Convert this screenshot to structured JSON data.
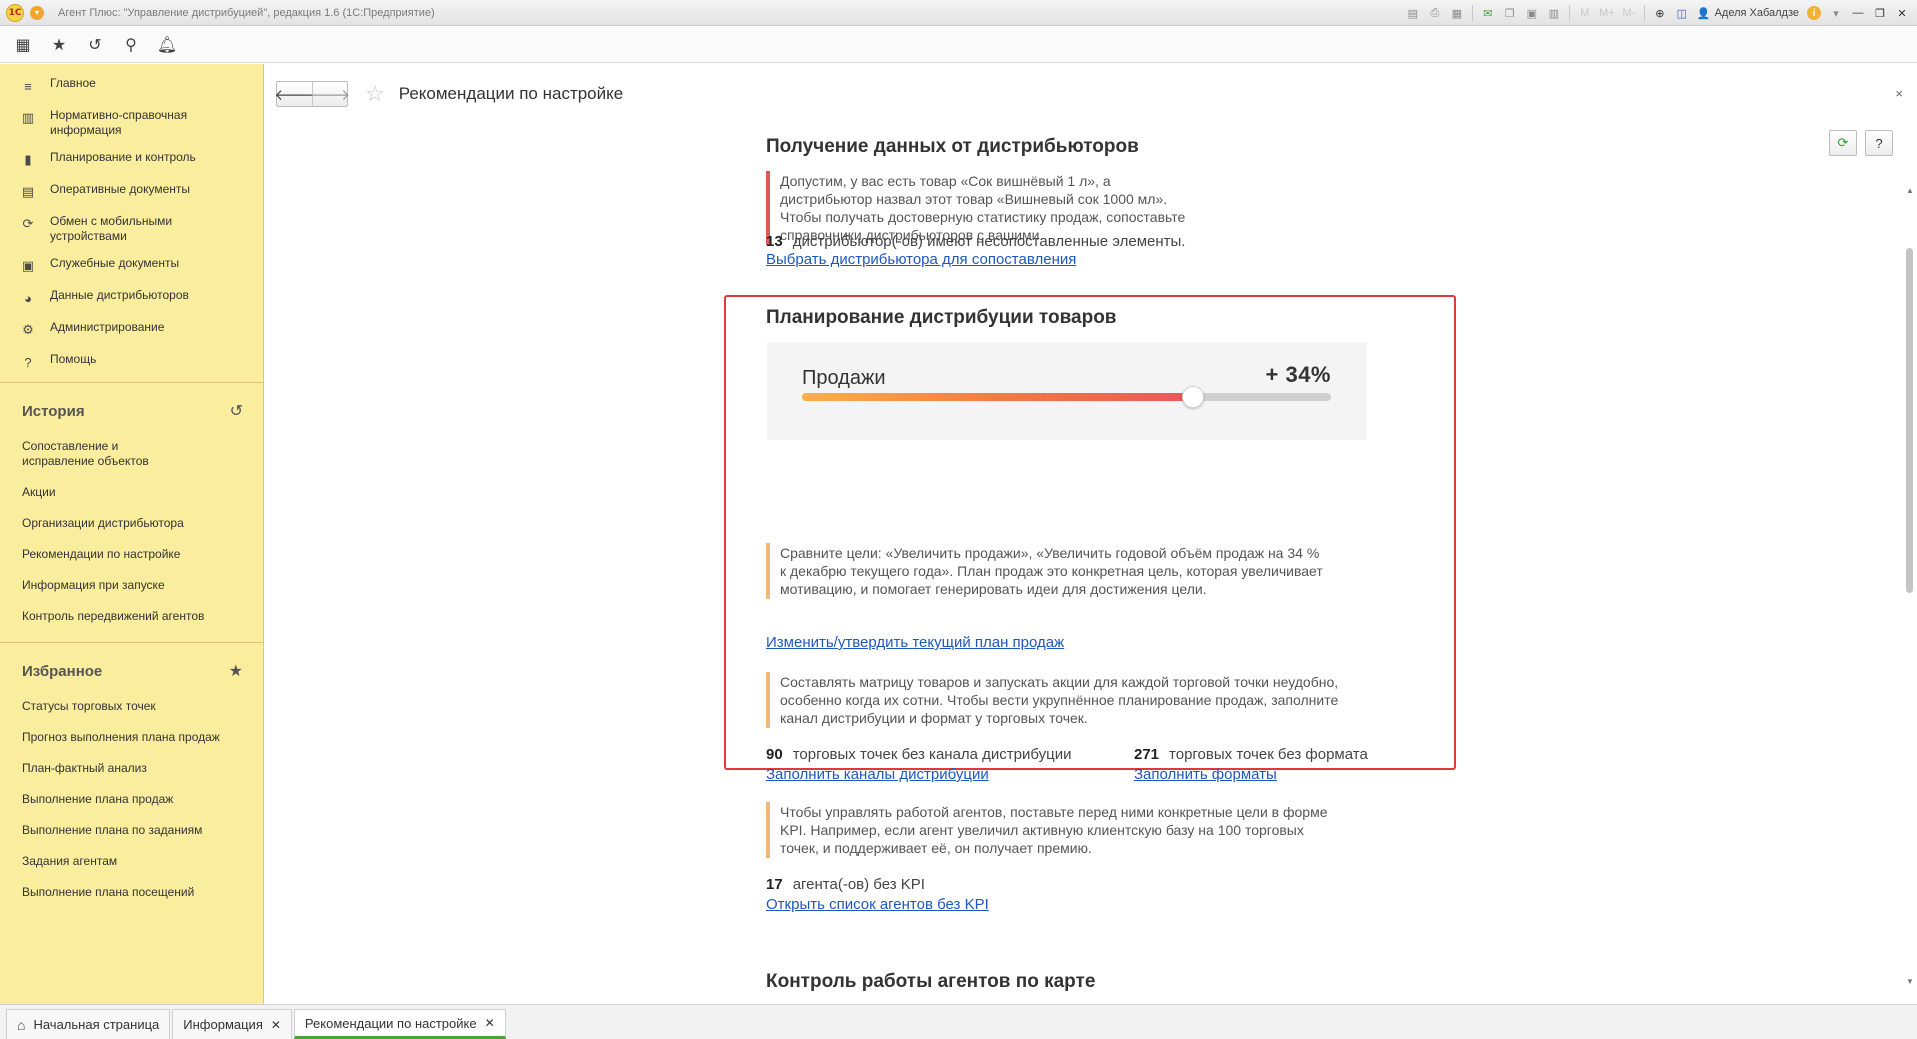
{
  "titlebar": {
    "logo_text": "1С",
    "title": "Агент Плюс: \"Управление дистрибуцией\", редакция 1.6 (1С:Предприятие)",
    "icons": [
      "save-icon",
      "print-icon",
      "preview-icon",
      "mail-icon",
      "copy-icon",
      "calendar-icon",
      "memory-icon",
      "zoom-icon",
      "panel-icon"
    ],
    "m_buttons": [
      "M",
      "M+",
      "M-"
    ],
    "user": "Аделя Хабалдзе",
    "info_icon": "i"
  },
  "toolbar": {
    "icons": [
      "apps-grid-icon",
      "star-icon",
      "history-icon",
      "search-icon",
      "bell-icon"
    ]
  },
  "sidebar": {
    "nav": [
      {
        "label": "Главное",
        "icon": "menu-icon"
      },
      {
        "label": "Нормативно-справочная информация",
        "icon": "book-icon"
      },
      {
        "label": "Планирование и контроль",
        "icon": "chart-icon"
      },
      {
        "label": "Оперативные документы",
        "icon": "documents-icon"
      },
      {
        "label": "Обмен с мобильными устройствами",
        "icon": "sync-icon"
      },
      {
        "label": "Служебные документы",
        "icon": "service-docs-icon"
      },
      {
        "label": "Данные дистрибьюторов",
        "icon": "pie-icon"
      },
      {
        "label": "Администрирование",
        "icon": "gear-icon"
      },
      {
        "label": "Помощь",
        "icon": "help-icon"
      }
    ],
    "history": {
      "title": "История",
      "items": [
        "Сопоставление и исправление объектов",
        "Акции",
        "Организации дистрибьютора",
        "Рекомендации по настройке",
        "Информация при запуске",
        "Контроль передвижений агентов"
      ]
    },
    "favorites": {
      "title": "Избранное",
      "items": [
        "Статусы торговых точек",
        "Прогноз выполнения плана продаж",
        "План-фактный анализ",
        "Выполнение плана продаж",
        "Выполнение плана по заданиям",
        "Задания агентам",
        "Выполнение плана посещений"
      ]
    }
  },
  "form": {
    "title": "Рекомендации по настройке",
    "close": "×",
    "help": "?"
  },
  "section1": {
    "title": "Получение данных от дистрибьюторов",
    "note": "Допустим, у вас есть товар «Сок вишнёвый 1 л», а дистрибьютор назвал этот товар «Вишневый сок 1000 мл». Чтобы получать достоверную статистику продаж, сопоставьте справочники дистрибьюторов с вашими.",
    "count": "13",
    "count_text": "дистрибьютор(-ов) имеют несопоставленные элементы.",
    "link": "Выбрать дистрибьютора для сопоставления"
  },
  "section2": {
    "title": "Планирование дистрибуции товаров",
    "sales_label": "Продажи",
    "sales_value": "+ 34%",
    "sales_level": 0.74,
    "note1": "Сравните цели: «Увеличить продажи», «Увеличить годовой объём продаж на 34 % к декабрю текущего года». План продаж это конкретная цель, которая увеличивает мотивацию, и помогает генерировать идеи для достижения цели.",
    "link1": "Изменить/утвердить текущий план продаж",
    "note2": "Составлять матрицу товаров и запускать акции для каждой торговой точки неудобно, особенно когда их сотни. Чтобы вести укрупнённое планирование продаж, заполните канал дистрибуции и формат у торговых точек.",
    "stat_a_count": "90",
    "stat_a_text": "торговых точек без канала дистрибуции",
    "stat_a_link": "Заполнить каналы дистрибуции",
    "stat_b_count": "271",
    "stat_b_text": "торговых точек без формата",
    "stat_b_link": "Заполнить форматы",
    "note3": "Чтобы управлять работой агентов, поставьте перед ними конкретные цели в форме KPI. Например, если агент увеличил активную клиентскую базу на 100 торговых точек, и поддерживает её, он получает премию.",
    "stat_c_count": "17",
    "stat_c_text": "агента(-ов) без KPI",
    "link3": "Открыть список агентов без KPI"
  },
  "section3": {
    "title": "Контроль работы агентов по карте"
  },
  "tabs": [
    {
      "label": "Начальная страница",
      "closable": false,
      "active": false
    },
    {
      "label": "Информация",
      "closable": true,
      "active": false
    },
    {
      "label": "Рекомендации по настройке",
      "closable": true,
      "active": true
    }
  ],
  "colors": {
    "sidebar_bg": "#fbed9e",
    "link": "#1f57c2",
    "highlight_border": "#e0383b",
    "note_red": "#e05a5a",
    "note_orange": "#f0b979",
    "active_tab": "#4aa43a"
  }
}
